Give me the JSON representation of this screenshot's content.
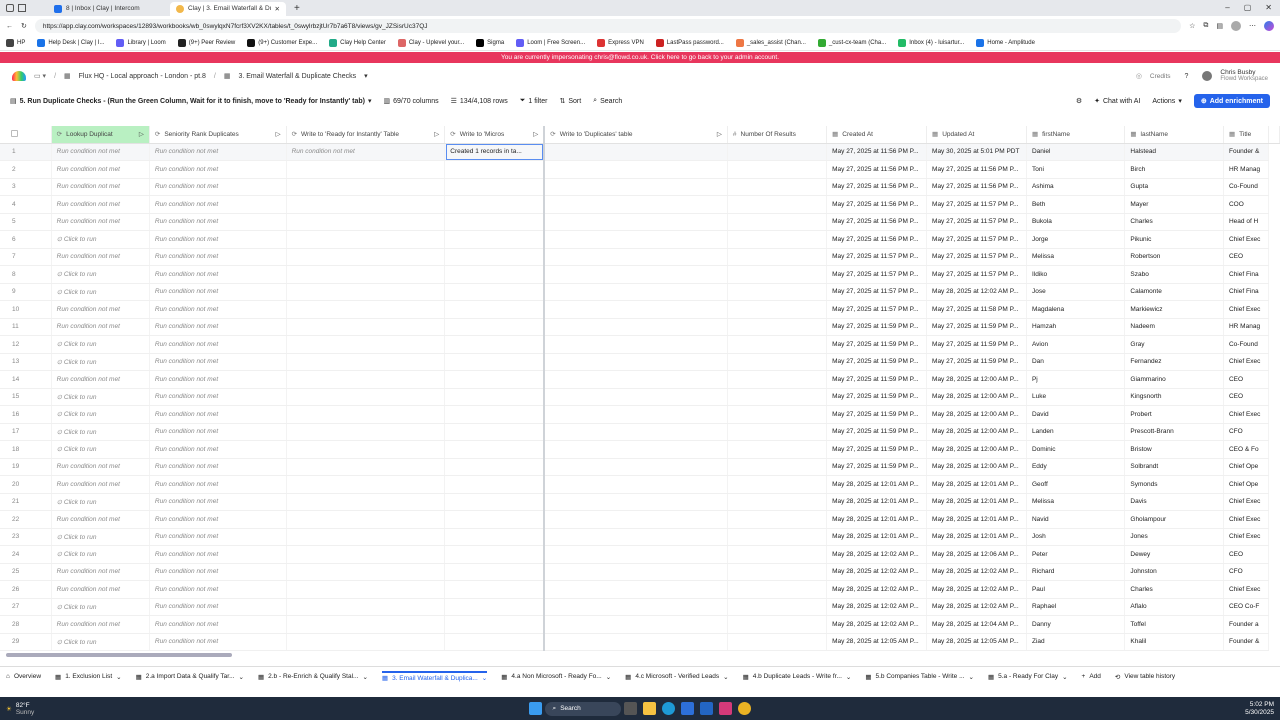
{
  "browser": {
    "tabs": [
      {
        "label": "8 | Inbox | Clay | Intercom",
        "active": false
      },
      {
        "label": "Clay | 3. Email Waterfall & Duplic...",
        "active": true
      }
    ],
    "url": "https://app.clay.com/workspaces/12893/workbooks/wb_0swylqxN7fcrf3XV2KX/tables/t_0swylrbzjtUr7b7a6T8/views/gv_JZSisrUc37QJ",
    "bookmarks": [
      "HP",
      "Help Desk | Clay | I...",
      "Library | Loom",
      "(9+) Peer Review",
      "(9+) Customer Expe...",
      "Clay Help Center",
      "Clay - Uplevel your...",
      "Sigma",
      "Loom | Free Screen...",
      "Express VPN",
      "LastPass password...",
      "_sales_assist (Chan...",
      "_cust-cx-team (Cha...",
      "Inbox (4) - luisartur...",
      "Home - Amplitude"
    ]
  },
  "banner": {
    "text": "You are currently impersonating chris@flowd.co.uk. Click here to go back to your admin account."
  },
  "nav": {
    "breadcrumb_workspace": "Flux HQ - Local approach - London - pt.8",
    "breadcrumb_table": "3. Email Waterfall & Duplicate Checks",
    "credits": "Credits",
    "user_name": "Chris Busby",
    "user_workspace": "Flowd Workspace"
  },
  "toolbar": {
    "view_name": "5. Run Duplicate Checks - (Run the Green Column, Wait for it to finish, move to 'Ready for Instantly' tab)",
    "columns": "69/70 columns",
    "rows": "134/4,108 rows",
    "filter": "1 filter",
    "sort": "Sort",
    "search": "Search",
    "chat": "Chat with AI",
    "actions": "Actions",
    "add_enrichment": "Add enrichment"
  },
  "columns": [
    "Lookup Duplicat",
    "Seniority Rank Duplicates",
    "Write to 'Ready for Instantly' Table",
    "Write to 'Micros",
    "Write to 'Duplicates' table",
    "Number Of Results",
    "Created At",
    "Updated At",
    "firstName",
    "lastName",
    "Title"
  ],
  "rows": [
    [
      "1",
      "Run condition not met",
      "Run condition not met",
      "Run condition not met",
      "Created 1 records in ta...",
      "",
      "",
      "May 27, 2025 at 11:56 PM P...",
      "May 30, 2025 at 5:01 PM PDT",
      "Daniel",
      "Halstead",
      "Founder &"
    ],
    [
      "2",
      "Run condition not met",
      "Run condition not met",
      "",
      "",
      "",
      "",
      "May 27, 2025 at 11:56 PM P...",
      "May 27, 2025 at 11:56 PM P...",
      "Toni",
      "Birch",
      "HR Manag"
    ],
    [
      "3",
      "Run condition not met",
      "Run condition not met",
      "",
      "",
      "",
      "",
      "May 27, 2025 at 11:56 PM P...",
      "May 27, 2025 at 11:56 PM P...",
      "Ashima",
      "Gupta",
      "Co-Found"
    ],
    [
      "4",
      "Run condition not met",
      "Run condition not met",
      "",
      "",
      "",
      "",
      "May 27, 2025 at 11:56 PM P...",
      "May 27, 2025 at 11:57 PM P...",
      "Beth",
      "Mayer",
      "COO"
    ],
    [
      "5",
      "Run condition not met",
      "Run condition not met",
      "",
      "",
      "",
      "",
      "May 27, 2025 at 11:56 PM P...",
      "May 27, 2025 at 11:57 PM P...",
      "Bukola",
      "Charles",
      "Head of H"
    ],
    [
      "6",
      "Click to run",
      "Run condition not met",
      "",
      "",
      "",
      "",
      "May 27, 2025 at 11:56 PM P...",
      "May 27, 2025 at 11:57 PM P...",
      "Jorge",
      "Pikunic",
      "Chief Exec"
    ],
    [
      "7",
      "Run condition not met",
      "Run condition not met",
      "",
      "",
      "",
      "",
      "May 27, 2025 at 11:57 PM P...",
      "May 27, 2025 at 11:57 PM P...",
      "Melissa",
      "Robertson",
      "CEO"
    ],
    [
      "8",
      "Click to run",
      "Run condition not met",
      "",
      "",
      "",
      "",
      "May 27, 2025 at 11:57 PM P...",
      "May 27, 2025 at 11:57 PM P...",
      "Ildiko",
      "Szabo",
      "Chief Fina"
    ],
    [
      "9",
      "Click to run",
      "Run condition not met",
      "",
      "",
      "",
      "",
      "May 27, 2025 at 11:57 PM P...",
      "May 28, 2025 at 12:02 AM P...",
      "Jose",
      "Calamonte",
      "Chief Fina"
    ],
    [
      "10",
      "Run condition not met",
      "Run condition not met",
      "",
      "",
      "",
      "",
      "May 27, 2025 at 11:57 PM P...",
      "May 27, 2025 at 11:58 PM P...",
      "Magdalena",
      "Markiewicz",
      "Chief Exec"
    ],
    [
      "11",
      "Run condition not met",
      "Run condition not met",
      "",
      "",
      "",
      "",
      "May 27, 2025 at 11:59 PM P...",
      "May 27, 2025 at 11:59 PM P...",
      "Hamzah",
      "Nadeem",
      "HR Manag"
    ],
    [
      "12",
      "Click to run",
      "Run condition not met",
      "",
      "",
      "",
      "",
      "May 27, 2025 at 11:59 PM P...",
      "May 27, 2025 at 11:59 PM P...",
      "Avion",
      "Gray",
      "Co-Found"
    ],
    [
      "13",
      "Click to run",
      "Run condition not met",
      "",
      "",
      "",
      "",
      "May 27, 2025 at 11:59 PM P...",
      "May 27, 2025 at 11:59 PM P...",
      "Dan",
      "Fernandez",
      "Chief Exec"
    ],
    [
      "14",
      "Run condition not met",
      "Run condition not met",
      "",
      "",
      "",
      "",
      "May 27, 2025 at 11:59 PM P...",
      "May 28, 2025 at 12:00 AM P...",
      "Pj",
      "Giammarino",
      "CEO"
    ],
    [
      "15",
      "Click to run",
      "Run condition not met",
      "",
      "",
      "",
      "",
      "May 27, 2025 at 11:59 PM P...",
      "May 28, 2025 at 12:00 AM P...",
      "Luke",
      "Kingsnorth",
      "CEO"
    ],
    [
      "16",
      "Click to run",
      "Run condition not met",
      "",
      "",
      "",
      "",
      "May 27, 2025 at 11:59 PM P...",
      "May 28, 2025 at 12:00 AM P...",
      "David",
      "Probert",
      "Chief Exec"
    ],
    [
      "17",
      "Click to run",
      "Run condition not met",
      "",
      "",
      "",
      "",
      "May 27, 2025 at 11:59 PM P...",
      "May 28, 2025 at 12:00 AM P...",
      "Landen",
      "Prescott-Brann",
      "CFO"
    ],
    [
      "18",
      "Click to run",
      "Run condition not met",
      "",
      "",
      "",
      "",
      "May 27, 2025 at 11:59 PM P...",
      "May 28, 2025 at 12:00 AM P...",
      "Dominic",
      "Bristow",
      "CEO & Fo"
    ],
    [
      "19",
      "Run condition not met",
      "Run condition not met",
      "",
      "",
      "",
      "",
      "May 27, 2025 at 11:59 PM P...",
      "May 28, 2025 at 12:00 AM P...",
      "Eddy",
      "Solbrandt",
      "Chief Ope"
    ],
    [
      "20",
      "Run condition not met",
      "Run condition not met",
      "",
      "",
      "",
      "",
      "May 28, 2025 at 12:01 AM P...",
      "May 28, 2025 at 12:01 AM P...",
      "Geoff",
      "Symonds",
      "Chief Ope"
    ],
    [
      "21",
      "Click to run",
      "Run condition not met",
      "",
      "",
      "",
      "",
      "May 28, 2025 at 12:01 AM P...",
      "May 28, 2025 at 12:01 AM P...",
      "Melissa",
      "Davis",
      "Chief Exec"
    ],
    [
      "22",
      "Run condition not met",
      "Run condition not met",
      "",
      "",
      "",
      "",
      "May 28, 2025 at 12:01 AM P...",
      "May 28, 2025 at 12:01 AM P...",
      "Navid",
      "Gholampour",
      "Chief Exec"
    ],
    [
      "23",
      "Click to run",
      "Run condition not met",
      "",
      "",
      "",
      "",
      "May 28, 2025 at 12:01 AM P...",
      "May 28, 2025 at 12:01 AM P...",
      "Josh",
      "Jones",
      "Chief Exec"
    ],
    [
      "24",
      "Click to run",
      "Run condition not met",
      "",
      "",
      "",
      "",
      "May 28, 2025 at 12:02 AM P...",
      "May 28, 2025 at 12:06 AM P...",
      "Peter",
      "Dewey",
      "CEO"
    ],
    [
      "25",
      "Run condition not met",
      "Run condition not met",
      "",
      "",
      "",
      "",
      "May 28, 2025 at 12:02 AM P...",
      "May 28, 2025 at 12:02 AM P...",
      "Richard",
      "Johnston",
      "CFO"
    ],
    [
      "26",
      "Run condition not met",
      "Run condition not met",
      "",
      "",
      "",
      "",
      "May 28, 2025 at 12:02 AM P...",
      "May 28, 2025 at 12:02 AM P...",
      "Paul",
      "Charles",
      "Chief Exec"
    ],
    [
      "27",
      "Click to run",
      "Run condition not met",
      "",
      "",
      "",
      "",
      "May 28, 2025 at 12:02 AM P...",
      "May 28, 2025 at 12:02 AM P...",
      "Raphael",
      "Aflalo",
      "CEO Co-F"
    ],
    [
      "28",
      "Run condition not met",
      "Run condition not met",
      "",
      "",
      "",
      "",
      "May 28, 2025 at 12:02 AM P...",
      "May 28, 2025 at 12:04 AM P...",
      "Danny",
      "Toffel",
      "Founder a"
    ],
    [
      "29",
      "Click to run",
      "Run condition not met",
      "",
      "",
      "",
      "",
      "May 28, 2025 at 12:05 AM P...",
      "May 28, 2025 at 12:05 AM P...",
      "Ziad",
      "Khalil",
      "Founder &"
    ]
  ],
  "sheet_tabs": [
    {
      "label": "Overview",
      "active": false
    },
    {
      "label": "1. Exclusion List",
      "active": false
    },
    {
      "label": "2.a Import Data & Qualify Tar...",
      "active": false
    },
    {
      "label": "2.b - Re-Enrich & Qualify Stal...",
      "active": false
    },
    {
      "label": "3. Email Waterfall & Duplica...",
      "active": true
    },
    {
      "label": "4.a Non Microsoft - Ready Fo...",
      "active": false
    },
    {
      "label": "4.c Microsoft - Verified Leads",
      "active": false
    },
    {
      "label": "4.b Duplicate Leads - Write fr...",
      "active": false
    },
    {
      "label": "5.b Companies Table - Write ...",
      "active": false
    },
    {
      "label": "5.a - Ready For Clay",
      "active": false
    }
  ],
  "bottom": {
    "add": "Add",
    "history": "View table history"
  },
  "taskbar": {
    "weather_temp": "82°F",
    "weather_desc": "Sunny",
    "search": "Search",
    "time": "5:02 PM",
    "date": "5/30/2025"
  }
}
